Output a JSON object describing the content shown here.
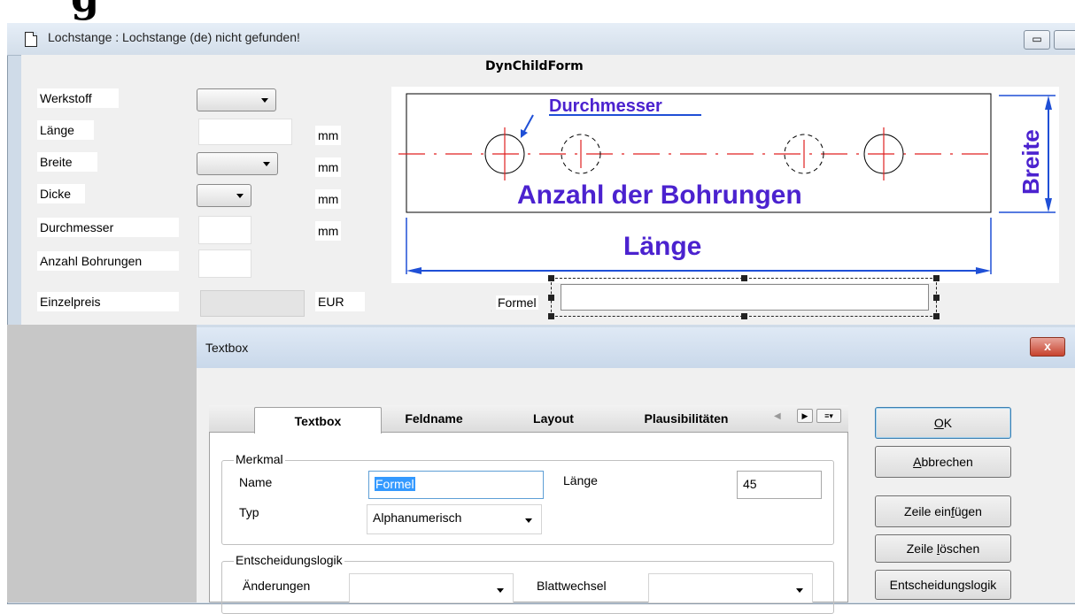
{
  "window": {
    "title": "Lochstange : Lochstange (de) nicht gefunden!",
    "minimize_symbol": "▭",
    "top_glyph": "g"
  },
  "form": {
    "title": "DynChildForm",
    "fields": {
      "werkstoff": "Werkstoff",
      "laenge": "Länge",
      "breite": "Breite",
      "dicke": "Dicke",
      "durchmesser": "Durchmesser",
      "anzahl": "Anzahl Bohrungen",
      "einzelpreis": "Einzelpreis"
    },
    "units": {
      "mm": "mm",
      "eur": "EUR"
    },
    "formel_label": "Formel"
  },
  "drawing": {
    "durchmesser": "Durchmesser",
    "anzahl": "Anzahl der Bohrungen",
    "laenge": "Länge",
    "breite": "Breite",
    "text_color": "#4b22cf",
    "center_line_color": "#e02020",
    "dimension_color": "#1f4fd6"
  },
  "dialog": {
    "title": "Textbox",
    "close": "x",
    "tabs": [
      "Textbox",
      "Feldname",
      "Layout",
      "Plausibilitäten"
    ],
    "nav": {
      "left": "◀",
      "right": "▶",
      "menu": "≡▾"
    },
    "merkmal": {
      "legend": "Merkmal",
      "name_label": "Name",
      "name_value": "Formel",
      "laenge_label": "Länge",
      "laenge_value": "45",
      "typ_label": "Typ",
      "typ_value": "Alphanumerisch"
    },
    "entscheidung": {
      "legend": "Entscheidungslogik",
      "aenderungen_label": "Änderungen",
      "blattwechsel_label": "Blattwechsel"
    },
    "buttons": {
      "ok_u": "O",
      "ok_rest": "K",
      "abbrechen_u": "A",
      "abbrechen_rest": "bbrechen",
      "einfuegen_pre": "Zeile ein",
      "einfuegen_u": "f",
      "einfuegen_rest": "ügen",
      "loeschen_pre": "Zeile ",
      "loeschen_u": "l",
      "loeschen_rest": "öschen",
      "entscheidungslogik": "Entscheidungslogik"
    }
  }
}
